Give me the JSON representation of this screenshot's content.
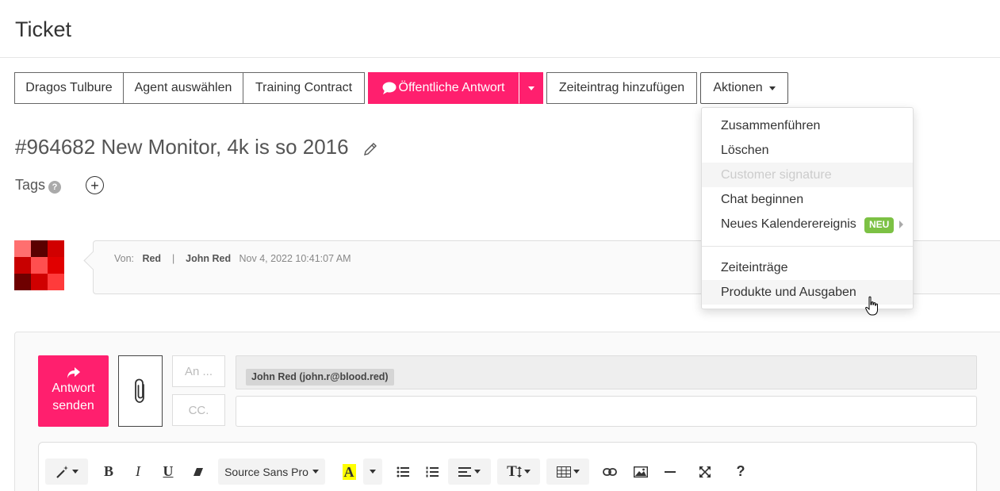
{
  "header": {
    "title": "Ticket"
  },
  "toolbar": {
    "customer": "Dragos Tulbure",
    "agent": "Agent auswählen",
    "contract": "Training Contract",
    "public_reply": "Öffentliche Antwort",
    "time_entry": "Zeiteintrag hinzufügen",
    "actions": "Aktionen"
  },
  "ticket": {
    "title": "#964682 New Monitor, 4k is so 2016",
    "tags_label": "Tags",
    "help_glyph": "?"
  },
  "avatar": {
    "colors": [
      "#ff6f6f",
      "#5a0000",
      "#d10000",
      "#c80000",
      "#ff4f4f",
      "#e10000",
      "#6e0000",
      "#d00000",
      "#ff3b3b"
    ]
  },
  "message": {
    "from_label": "Von:",
    "from_name": "Red",
    "separator": "|",
    "author": "John Red",
    "timestamp": "Nov 4, 2022 10:41:07 AM"
  },
  "composer": {
    "send_line1": "Antwort",
    "send_line2": "senden",
    "to_label": "An ...",
    "cc_label": "CC.",
    "recipient": "John Red (john.r@blood.red)"
  },
  "editor_toolbar": {
    "bold": "B",
    "italic": "I",
    "underline": "U",
    "font": "Source Sans Pro",
    "color_letter": "A",
    "text_size": "T",
    "help": "?"
  },
  "actions_menu": {
    "items": [
      {
        "label": "Zusammenführen",
        "state": "normal"
      },
      {
        "label": "Löschen",
        "state": "normal"
      },
      {
        "label": "Customer signature",
        "state": "disabled"
      },
      {
        "label": "Chat beginnen",
        "state": "normal"
      },
      {
        "label": "Neues Kalenderereignis",
        "state": "normal",
        "badge": "NEU"
      },
      {
        "label": "Zeiteinträge",
        "state": "normal"
      },
      {
        "label": "Produkte und Ausgaben",
        "state": "hover"
      }
    ]
  },
  "colors": {
    "accent": "#ff1f6e",
    "badge": "#7cc144"
  }
}
